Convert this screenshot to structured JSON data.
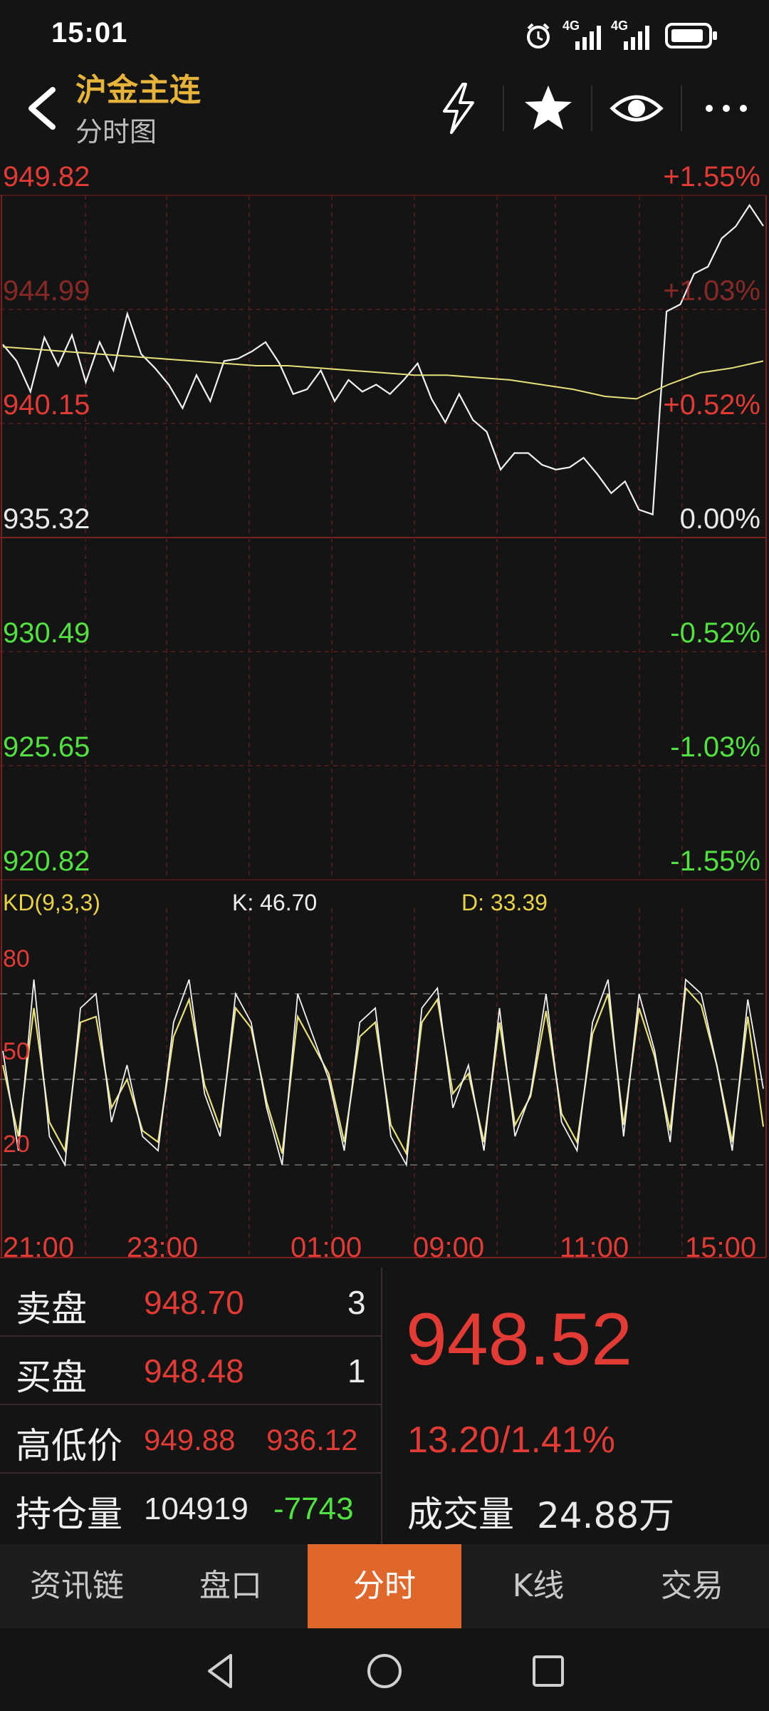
{
  "status_bar": {
    "time": "15:01",
    "net1": "4G",
    "net2": "4G"
  },
  "header": {
    "title": "沪金主连",
    "subtitle": "分时图",
    "icons": [
      "back-icon",
      "lightning-icon",
      "star-icon",
      "eye-icon",
      "more-icon"
    ]
  },
  "price_axis": {
    "left": [
      "949.82",
      "944.99",
      "940.15",
      "935.32",
      "930.49",
      "925.65",
      "920.82"
    ],
    "right": [
      "+1.55%",
      "+1.03%",
      "+0.52%",
      "0.00%",
      "-0.52%",
      "-1.03%",
      "-1.55%"
    ]
  },
  "kd": {
    "label": "KD(9,3,3)",
    "k": "K: 46.70",
    "d": "D: 33.39",
    "levels": [
      "80",
      "50",
      "20"
    ]
  },
  "time_axis": [
    "21:00",
    "23:00",
    "01:00",
    "09:00",
    "11:00",
    "15:00"
  ],
  "quote": {
    "sell_label": "卖盘",
    "sell_price": "948.70",
    "sell_qty": "3",
    "buy_label": "买盘",
    "buy_price": "948.48",
    "buy_qty": "1",
    "hl_label": "高低价",
    "high": "949.88",
    "low": "936.12",
    "oi_label": "持仓量",
    "oi": "104919",
    "oi_change": "-7743",
    "last": "948.52",
    "change": "13.20/1.41%",
    "vol_label": "成交量",
    "vol": "24.88万"
  },
  "tabs": [
    "资讯链",
    "盘口",
    "分时",
    "K线",
    "交易"
  ],
  "active_tab": "分时",
  "colors": {
    "up": "#e23a35",
    "down": "#52e042",
    "accent": "#e0672c",
    "title": "#e7b43b",
    "avg_line": "#e8e07a"
  },
  "chart_data": {
    "type": "line",
    "title": "",
    "xlabel": "",
    "ylabel": "",
    "x_ticks": [
      "21:00",
      "23:00",
      "01:00",
      "09:00",
      "11:00",
      "15:00"
    ],
    "ylim": [
      920.82,
      949.82
    ],
    "prev_close": 935.32,
    "series": [
      {
        "values": [
          943.5,
          942.8,
          941.5,
          943.8,
          942.6,
          943.9,
          941.9,
          943.6,
          942.4,
          944.8,
          943.1,
          942.5,
          941.8,
          940.8,
          942.2,
          941.1,
          942.8,
          942.9,
          943.2,
          943.6,
          942.7,
          941.4,
          941.6,
          942.4,
          941.1,
          942.0,
          941.5,
          941.8,
          941.4,
          942.0,
          942.7,
          941.2,
          940.2,
          941.4,
          940.3,
          939.8,
          938.2,
          938.9,
          938.9,
          938.4,
          938.2,
          938.3,
          938.7,
          938.0,
          937.2,
          937.7,
          936.5,
          936.3,
          944.9,
          945.2,
          946.5,
          946.8,
          948.0,
          948.5,
          949.4,
          948.52
        ]
      },
      {
        "values": [
          943.4,
          943.3,
          943.2,
          943.1,
          943.0,
          942.9,
          942.8,
          942.7,
          942.6,
          942.6,
          942.5,
          942.4,
          942.3,
          942.2,
          942.2,
          942.1,
          942.0,
          941.8,
          941.6,
          941.3,
          941.2,
          941.8,
          942.3,
          942.5,
          942.8
        ]
      }
    ],
    "kd": {
      "k": [
        60,
        25,
        85,
        30,
        20,
        75,
        80,
        35,
        55,
        30,
        25,
        70,
        85,
        45,
        30,
        80,
        70,
        40,
        20,
        80,
        65,
        50,
        25,
        70,
        75,
        30,
        20,
        75,
        82,
        40,
        55,
        25,
        75,
        30,
        45,
        80,
        35,
        25,
        70,
        85,
        30,
        80,
        60,
        28,
        85,
        80,
        55,
        25,
        78,
        46.7
      ],
      "d": [
        55,
        30,
        75,
        35,
        25,
        70,
        72,
        40,
        50,
        32,
        28,
        65,
        78,
        48,
        33,
        75,
        68,
        42,
        24,
        72,
        62,
        52,
        28,
        65,
        70,
        34,
        24,
        70,
        78,
        45,
        52,
        28,
        70,
        34,
        44,
        74,
        38,
        28,
        66,
        80,
        34,
        75,
        58,
        32,
        82,
        76,
        55,
        28,
        72,
        33.39
      ]
    }
  }
}
